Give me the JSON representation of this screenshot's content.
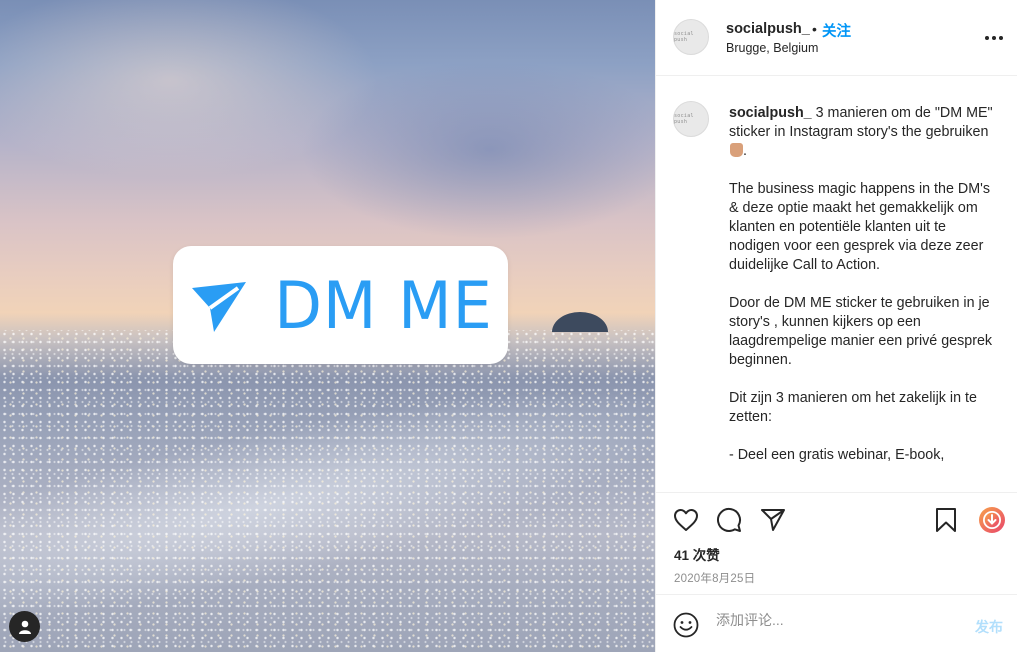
{
  "post": {
    "sticker_text": "DM ME",
    "sticker_icon": "paper-plane-icon",
    "accent_color": "#2a9df4"
  },
  "header": {
    "username": "socialpush_",
    "separator": "•",
    "follow_label": "关注",
    "location": "Brugge, Belgium"
  },
  "caption": {
    "username": "socialpush_",
    "text": " 3 manieren om de \"DM ME\" sticker in Instagram story's the gebruiken",
    "text_end": ".\n\nThe business magic happens in the DM's & deze optie maakt het gemakkelijk om klanten en potentiële klanten uit te nodigen voor een gesprek via deze zeer duidelijke Call to Action.\n\nDoor de DM ME sticker te gebruiken in je story's , kunnen kijkers op een laagdrempelige manier een privé gesprek beginnen.\n\nDit zijn 3 manieren om het zakelijk in te zetten:\n\n- Deel een gratis webinar, E-book,"
  },
  "actions": {
    "likes": "41 次赞",
    "date": "2020年8月25日"
  },
  "comment": {
    "placeholder": "添加评论...",
    "post_label": "发布"
  },
  "colors": {
    "follow": "#0095f6",
    "text": "#262626",
    "muted": "#8e8e8e",
    "post_disabled": "#b2dffc"
  }
}
